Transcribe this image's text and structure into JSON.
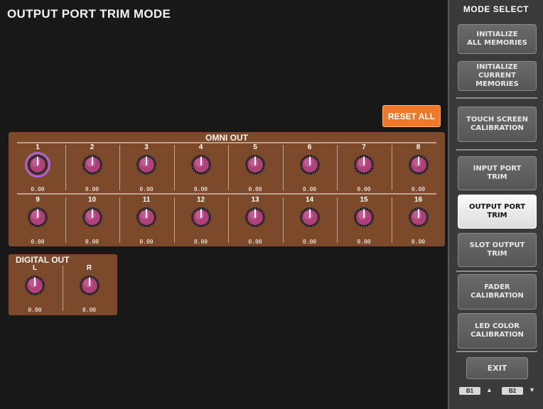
{
  "title": "OUTPUT PORT TRIM MODE",
  "reset_all_label": "RESET ALL",
  "omni_out": {
    "title": "OMNI OUT",
    "row1": [
      {
        "num": "1",
        "value": "0.00",
        "selected": true
      },
      {
        "num": "2",
        "value": "0.00"
      },
      {
        "num": "3",
        "value": "0.00"
      },
      {
        "num": "4",
        "value": "0.00"
      },
      {
        "num": "5",
        "value": "0.00"
      },
      {
        "num": "6",
        "value": "0.00"
      },
      {
        "num": "7",
        "value": "0.00"
      },
      {
        "num": "8",
        "value": "0.00"
      }
    ],
    "row2": [
      {
        "num": "9",
        "value": "0.00"
      },
      {
        "num": "10",
        "value": "0.00"
      },
      {
        "num": "11",
        "value": "0.00"
      },
      {
        "num": "12",
        "value": "0.00"
      },
      {
        "num": "13",
        "value": "0.00"
      },
      {
        "num": "14",
        "value": "0.00"
      },
      {
        "num": "15",
        "value": "0.00"
      },
      {
        "num": "16",
        "value": "0.00"
      }
    ]
  },
  "digital_out": {
    "title": "DIGITAL OUT",
    "channels": [
      {
        "num": "L",
        "value": "0.00"
      },
      {
        "num": "R",
        "value": "0.00"
      }
    ]
  },
  "sidebar": {
    "title": "MODE SELECT",
    "buttons": [
      {
        "label": "INITIALIZE\nALL MEMORIES",
        "active": false
      },
      {
        "label": "INITIALIZE\nCURRENT MEMORIES",
        "active": false
      },
      {
        "label": "TOUCH SCREEN\nCALIBRATION",
        "active": false
      },
      {
        "label": "INPUT PORT\nTRIM",
        "active": false
      },
      {
        "label": "OUTPUT PORT\nTRIM",
        "active": true
      },
      {
        "label": "SLOT OUTPUT\nTRIM",
        "active": false
      },
      {
        "label": "FADER\nCALIBRATION",
        "active": false
      },
      {
        "label": "LED COLOR\nCALIBRATION",
        "active": false
      }
    ],
    "exit_label": "EXIT",
    "bank": {
      "b1": "B1",
      "b2": "B2"
    }
  },
  "colors": {
    "panel": "#7c4a2a",
    "reset": "#f07828",
    "knob": "#b0407a",
    "selected_ring": "#b060d8"
  },
  "icons": {
    "knob": "trim-knob-icon",
    "bank_up": "triangle-up-icon",
    "bank_down": "triangle-down-icon"
  }
}
